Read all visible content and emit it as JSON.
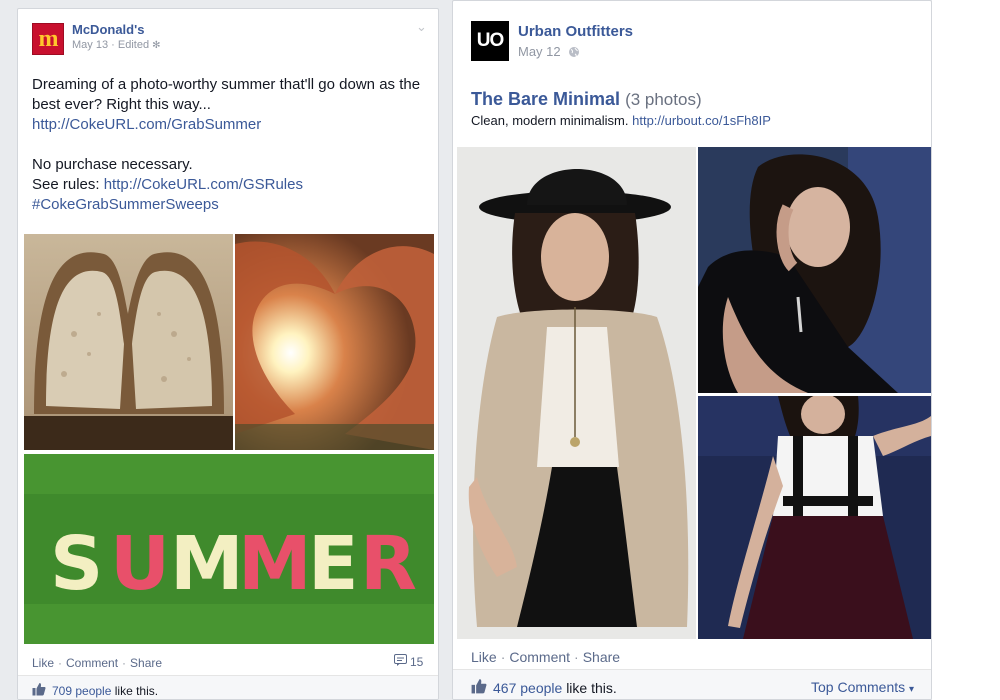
{
  "posts": [
    {
      "author": "McDonald's",
      "avatar_letter": "m",
      "date": "May 13",
      "edited": "Edited",
      "body": {
        "line1": "Dreaming of a photo-worthy summer that'll go down as the best ever? Right this way...",
        "link1": "http://CokeURL.com/GrabSummer",
        "line2": "No purchase necessary.",
        "rules_label": "See rules:",
        "link2": "http://CokeURL.com/GSRules",
        "hashtag": "#CokeGrabSummerSweeps"
      },
      "actions": {
        "like": "Like",
        "comment": "Comment",
        "share": "Share"
      },
      "comment_count": "15",
      "likes_count": "709 people",
      "likes_suffix": "like this."
    },
    {
      "author": "Urban Outfitters",
      "avatar_letter": "UO",
      "date": "May 12",
      "album_title": "The Bare Minimal",
      "album_count": "(3 photos)",
      "desc": "Clean, modern minimalism.",
      "desc_link": "http://urbout.co/1sFh8IP",
      "actions": {
        "like": "Like",
        "comment": "Comment",
        "share": "Share"
      },
      "likes_count": "467 people",
      "likes_suffix": "like this.",
      "top_comments": "Top Comments"
    }
  ],
  "colors": {
    "link": "#3b5998",
    "meta": "#9197a3",
    "background": "#e9ebee"
  },
  "icons": [
    "globe-icon",
    "chevron-down-icon",
    "comment-icon",
    "thumbs-up-icon",
    "caret-down-icon"
  ]
}
